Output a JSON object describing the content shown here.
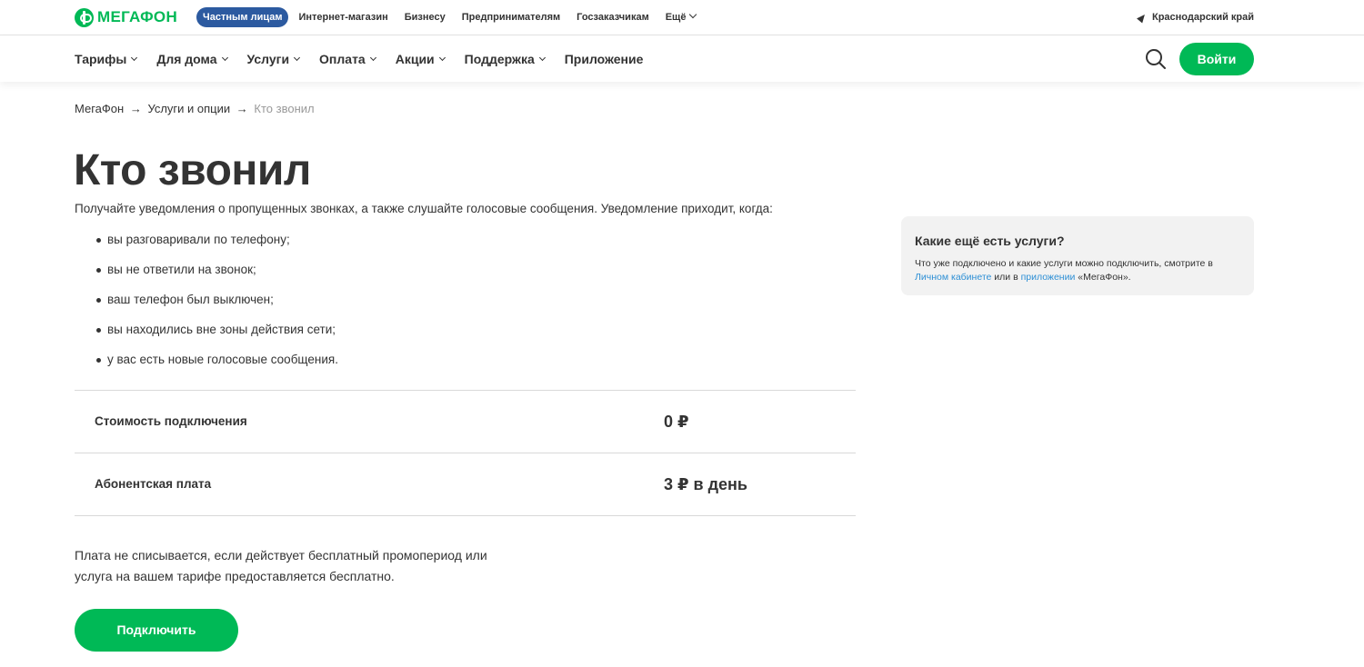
{
  "logo": {
    "text": "МЕГАФОН",
    "icon": "megafon-logo-icon",
    "color": "#00b956"
  },
  "segments": [
    {
      "label": "Частным лицам",
      "active": true
    },
    {
      "label": "Интернет-магазин"
    },
    {
      "label": "Бизнесу"
    },
    {
      "label": "Предпринимателям"
    },
    {
      "label": "Госзаказчикам"
    },
    {
      "label": "Ещё",
      "dropdown": true
    }
  ],
  "region": {
    "label": "Краснодарский край",
    "icon": "location-arrow-icon"
  },
  "nav": {
    "items": [
      {
        "label": "Тарифы",
        "dropdown": true
      },
      {
        "label": "Для дома",
        "dropdown": true
      },
      {
        "label": "Услуги",
        "dropdown": true
      },
      {
        "label": "Оплата",
        "dropdown": true
      },
      {
        "label": "Акции",
        "dropdown": true
      },
      {
        "label": "Поддержка",
        "dropdown": true
      },
      {
        "label": "Приложение",
        "dropdown": false
      }
    ],
    "search_icon": "search-icon",
    "login_label": "Войти"
  },
  "breadcrumb": {
    "items": [
      "МегаФон",
      "Услуги и опции",
      "Кто звонил"
    ],
    "separator": "→"
  },
  "main": {
    "title": "Кто звонил",
    "intro": "Получайте уведомления о пропущенных звонках, а также слушайте голосовые сообщения. Уведомление приходит, когда:",
    "bullets": [
      "вы разговаривали по телефону;",
      "вы не ответили на звонок;",
      "ваш телефон был выключен;",
      "вы находились вне зоны действия сети;",
      "у вас есть новые голосовые сообщения."
    ],
    "prices": [
      {
        "label": "Стоимость подключения",
        "value": "0 ₽"
      },
      {
        "label": "Абонентская плата",
        "value": "3 ₽ в день"
      }
    ],
    "note": "Плата не списывается, если действует бесплатный промопериод или услуга на вашем тарифе предоставляется бесплатно.",
    "connect_label": "Подключить"
  },
  "side_card": {
    "title": "Какие ещё есть услуги?",
    "text_1": "Что уже подключено и какие услуги можно подключить, смотрите в ",
    "link_1": "Личном кабинете",
    "text_2": " или в ",
    "link_2": "приложении",
    "text_3": " «МегаФон»."
  },
  "colors": {
    "accent": "#00b956",
    "segment_active": "#2c5aa0",
    "link": "#2d8fd5",
    "card_bg": "#f2f2f2"
  }
}
